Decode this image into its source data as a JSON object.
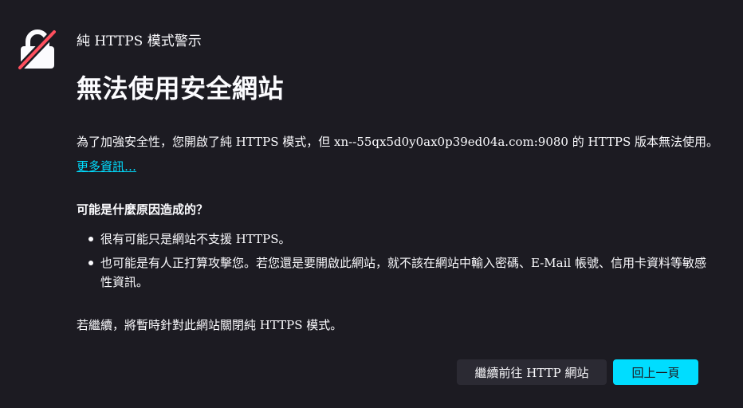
{
  "header": {
    "small_title": "純 HTTPS 模式警示",
    "large_title": "無法使用安全網站"
  },
  "main": {
    "description": "為了加強安全性，您開啟了純 HTTPS 模式，但 xn--55qx5d0y0ax0p39ed04a.com:9080 的 HTTPS 版本無法使用。",
    "learn_more": "更多資訊…",
    "section_heading": "可能是什麼原因造成的？",
    "reasons": [
      {
        "text": "很有可能只是網站不支援 HTTPS。"
      },
      {
        "text": "也可能是有人正打算攻擊您。若您還是要開啟此網站，就不該在網站中輸入密碼、E-Mail 帳號、信用卡資料等敏感性資訊。"
      }
    ],
    "continue_note": "若繼續，將暫時針對此網站關閉純 HTTPS 模式。"
  },
  "buttons": {
    "continue_http": "繼續前往 HTTP 網站",
    "go_back": "回上一頁"
  },
  "icons": {
    "warning": "broken-lock-icon"
  },
  "colors": {
    "background": "#1c1b22",
    "accent": "#00ddff",
    "warning_slash": "#ff4f5e",
    "secondary_button": "#2b2a33"
  }
}
